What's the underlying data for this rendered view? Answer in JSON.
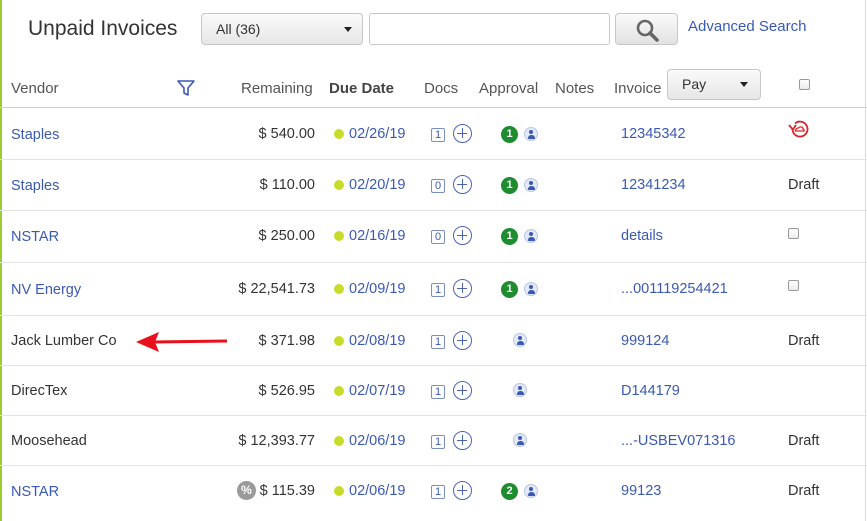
{
  "page": {
    "title": "Unpaid Invoices",
    "filter_select": "All (36)",
    "search_placeholder": "",
    "advanced_search": "Advanced Search"
  },
  "columns": {
    "vendor": "Vendor",
    "remaining": "Remaining",
    "due_date": "Due Date",
    "docs": "Docs",
    "approval": "Approval",
    "notes": "Notes",
    "invoice": "Invoice",
    "pay_select": "Pay"
  },
  "rows": [
    {
      "vendor": "Staples",
      "vendor_link": true,
      "remaining": "$ 540.00",
      "due_date": "02/26/19",
      "docs": "1",
      "approvals": "1",
      "invoice": "12345342",
      "status": "",
      "status_kind": "restore-icon"
    },
    {
      "vendor": "Staples",
      "vendor_link": true,
      "remaining": "$ 110.00",
      "due_date": "02/20/19",
      "docs": "0",
      "approvals": "1",
      "invoice": "12341234",
      "status": "Draft",
      "status_kind": "text"
    },
    {
      "vendor": "NSTAR",
      "vendor_link": true,
      "remaining": "$ 250.00",
      "due_date": "02/16/19",
      "docs": "0",
      "approvals": "1",
      "invoice": "details",
      "status": "",
      "status_kind": "checkbox"
    },
    {
      "vendor": "NV Energy",
      "vendor_link": true,
      "remaining": "$ 22,541.73",
      "due_date": "02/09/19",
      "docs": "1",
      "approvals": "1",
      "invoice": "...001119254421",
      "status": "",
      "status_kind": "checkbox"
    },
    {
      "vendor": "Jack Lumber Co",
      "vendor_link": false,
      "remaining": "$ 371.98",
      "due_date": "02/08/19",
      "docs": "1",
      "approvals": "",
      "invoice": "999124",
      "status": "Draft",
      "status_kind": "text"
    },
    {
      "vendor": "DirecTex",
      "vendor_link": false,
      "remaining": "$ 526.95",
      "due_date": "02/07/19",
      "docs": "1",
      "approvals": "",
      "invoice": "D144179",
      "status": "Draft",
      "status_kind": "text"
    },
    {
      "vendor": "Moosehead",
      "vendor_link": false,
      "remaining": "$ 12,393.77",
      "due_date": "02/06/19",
      "docs": "1",
      "approvals": "",
      "invoice": "...-USBEV071316",
      "status": "Draft",
      "status_kind": "text"
    },
    {
      "vendor": "NSTAR",
      "vendor_link": true,
      "remaining": "$ 115.39",
      "due_date": "02/06/19",
      "docs": "1",
      "approvals": "2",
      "invoice": "99123",
      "status": "Draft",
      "status_kind": "text",
      "percent_badge": "%"
    }
  ],
  "colors": {
    "link": "#3a59b4",
    "due_dot": "#c7dc2a",
    "approval_badge": "#1f8c2f",
    "arrow": "#e8101a",
    "accent": "#9ccc2f"
  },
  "icons": [
    "search-icon",
    "filter-funnel-icon",
    "plus-circle-icon",
    "person-icon",
    "restore-icon",
    "percent-icon",
    "arrow-left-icon"
  ]
}
